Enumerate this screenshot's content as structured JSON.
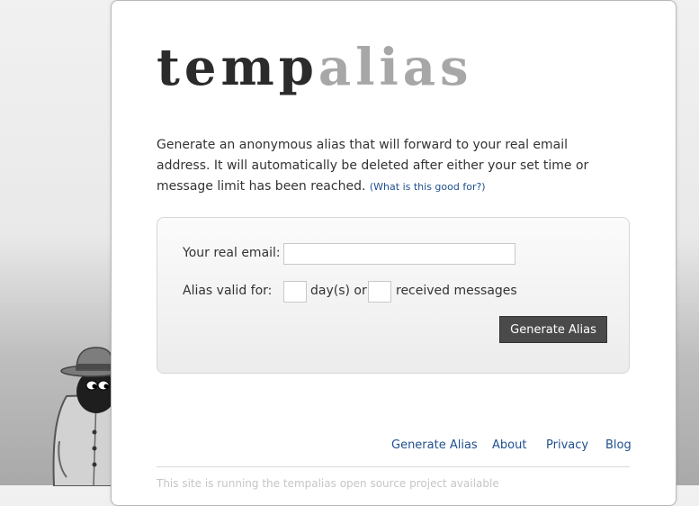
{
  "logo": {
    "part1": "temp",
    "part2": "alias"
  },
  "intro": {
    "text": "Generate an anonymous alias that will forward to your real email address. It will automatically be deleted after either your set time or message limit has been reached.",
    "link": "(What is this good for?)"
  },
  "form": {
    "email_label": "Your real email:",
    "email_value": "",
    "valid_label": "Alias valid for:",
    "days_value": "",
    "days_suffix": "day(s) or",
    "messages_value": "",
    "messages_suffix": "received messages",
    "submit_label": "Generate Alias"
  },
  "nav": {
    "items": [
      {
        "label": "Generate Alias"
      },
      {
        "label": "About"
      },
      {
        "label": "Privacy"
      },
      {
        "label": "Blog"
      }
    ]
  },
  "footer": {
    "text": "This site is running the tempalias open source project available"
  },
  "mascot": {
    "icon": "spy-mascot"
  },
  "colors": {
    "link": "#1f4f8f",
    "button": "#4a4a4a",
    "logo_dark": "#2b2b2b",
    "logo_light": "#a7a7a7"
  }
}
